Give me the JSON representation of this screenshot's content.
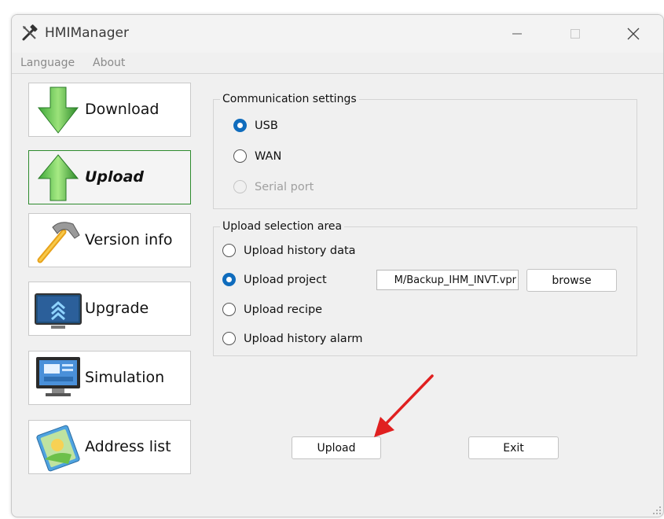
{
  "window": {
    "title": "HMIManager"
  },
  "menu": {
    "language": "Language",
    "about": "About"
  },
  "nav": {
    "download": "Download",
    "upload": "Upload",
    "version_info": "Version info",
    "upgrade": "Upgrade",
    "simulation": "Simulation",
    "address_list": "Address list",
    "selected": "Upload"
  },
  "communication": {
    "title": "Communication settings",
    "options": [
      "USB",
      "WAN",
      "Serial port"
    ],
    "selected": "USB",
    "disabled": [
      "Serial port"
    ]
  },
  "upload_area": {
    "title": "Upload selection area",
    "options": [
      "Upload history data",
      "Upload project",
      "Upload recipe",
      "Upload history alarm"
    ],
    "selected": "Upload project",
    "path_value": "M/Backup_IHM_INVT.vpr",
    "browse_label": "browse"
  },
  "actions": {
    "upload_label": "Upload",
    "exit_label": "Exit"
  },
  "colors": {
    "accent": "#0f6cbd",
    "selected_border": "#2e8b2e",
    "annotation_arrow": "#e02020"
  },
  "icons": [
    "hammer-screwdriver-icon",
    "minimize-icon",
    "maximize-icon",
    "close-icon",
    "download-arrow-icon",
    "upload-arrow-icon",
    "hammer-icon",
    "upgrade-monitor-icon",
    "simulation-monitor-icon",
    "address-book-icon",
    "resize-grip-icon"
  ]
}
